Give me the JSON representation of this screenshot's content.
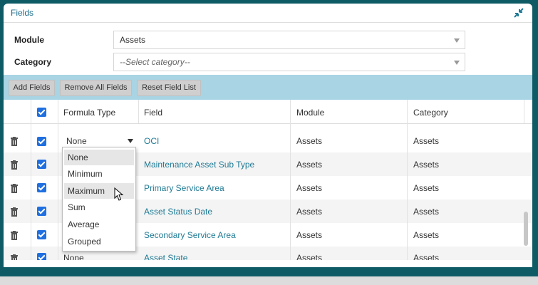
{
  "dialog": {
    "title": "Fields"
  },
  "form": {
    "module_label": "Module",
    "module_value": "Assets",
    "category_label": "Category",
    "category_placeholder": "--Select category--"
  },
  "toolbar": {
    "add_fields": "Add Fields",
    "remove_all_fields": "Remove All Fields",
    "reset_field_list": "Reset Field List"
  },
  "grid": {
    "columns": [
      "Formula Type",
      "Field",
      "Module",
      "Category"
    ],
    "rows": [
      {
        "formula": "None",
        "field": "OCI",
        "module": "Assets",
        "category": "Assets"
      },
      {
        "formula": "",
        "field": "Maintenance Asset Sub Type",
        "module": "Assets",
        "category": "Assets"
      },
      {
        "formula": "",
        "field": "Primary Service Area",
        "module": "Assets",
        "category": "Assets"
      },
      {
        "formula": "",
        "field": "Asset Status Date",
        "module": "Assets",
        "category": "Assets"
      },
      {
        "formula": "",
        "field": "Secondary Service Area",
        "module": "Assets",
        "category": "Assets"
      },
      {
        "formula": "None",
        "field": "Asset State",
        "module": "Assets",
        "category": "Assets"
      }
    ]
  },
  "formula_menu": {
    "options": [
      "None",
      "Minimum",
      "Maximum",
      "Sum",
      "Average",
      "Grouped"
    ],
    "selected": "None",
    "hovered": "Maximum"
  },
  "colors": {
    "background": "#0e5b66",
    "toolbar": "#a8d4e3",
    "link": "#1e7a95",
    "checkbox": "#1f6fe0"
  }
}
